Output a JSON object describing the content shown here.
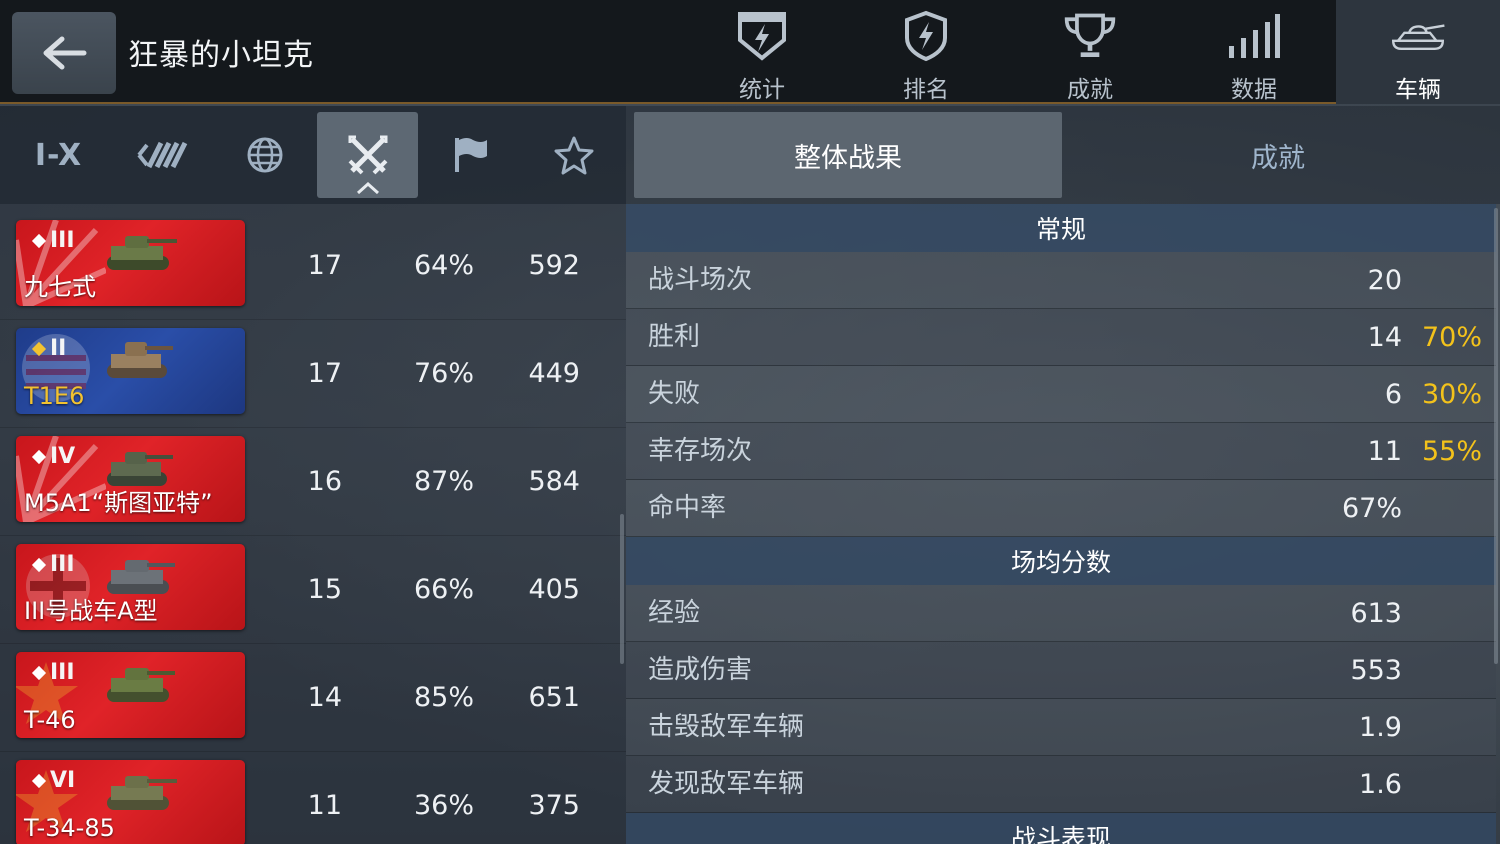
{
  "header": {
    "player_name": "狂暴的小坦克",
    "nav": [
      {
        "label": "统计",
        "icon": "shield-lightning-icon"
      },
      {
        "label": "排名",
        "icon": "badge-lightning-icon"
      },
      {
        "label": "成就",
        "icon": "trophy-icon"
      },
      {
        "label": "数据",
        "icon": "signal-bars-icon"
      },
      {
        "label": "车辆",
        "icon": "tank-icon",
        "active": true
      }
    ]
  },
  "filters": {
    "tier_label": "I-X",
    "items": [
      "tier-filter",
      "vehicle-type-filter",
      "nation-filter",
      "battles-sort",
      "flag-filter",
      "star-filter"
    ],
    "active": "battles-sort"
  },
  "tanks": [
    {
      "tier": "III",
      "name": "九七式",
      "battles": "17",
      "win_rate": "64%",
      "avg_exp": "592",
      "color": "red"
    },
    {
      "tier": "II",
      "name": "T1E6",
      "battles": "17",
      "win_rate": "76%",
      "avg_exp": "449",
      "color": "blue",
      "premium": true
    },
    {
      "tier": "IV",
      "name": "M5A1“斯图亚特”",
      "battles": "16",
      "win_rate": "87%",
      "avg_exp": "584",
      "color": "red"
    },
    {
      "tier": "III",
      "name": "III号战车A型",
      "battles": "15",
      "win_rate": "66%",
      "avg_exp": "405",
      "color": "red"
    },
    {
      "tier": "III",
      "name": "T-46",
      "battles": "14",
      "win_rate": "85%",
      "avg_exp": "651",
      "color": "red"
    },
    {
      "tier": "VI",
      "name": "T-34-85",
      "battles": "11",
      "win_rate": "36%",
      "avg_exp": "375",
      "color": "red"
    }
  ],
  "right_tabs": {
    "overall": "整体战果",
    "achievements": "成就"
  },
  "stats": {
    "general": {
      "title": "常规",
      "battles_label": "战斗场次",
      "battles": "20",
      "victories_label": "胜利",
      "victories": "14",
      "victories_pct": "70%",
      "defeats_label": "失败",
      "defeats": "6",
      "defeats_pct": "30%",
      "survived_label": "幸存场次",
      "survived": "11",
      "survived_pct": "55%",
      "hit_ratio_label": "命中率",
      "hit_ratio": "67%"
    },
    "average": {
      "title": "场均分数",
      "exp_label": "经验",
      "exp": "613",
      "damage_label": "造成伤害",
      "damage": "553",
      "kills_label": "击毁敌军车辆",
      "kills": "1.9",
      "spotted_label": "发现敌军车辆",
      "spotted": "1.6"
    },
    "performance": {
      "title": "战斗表现"
    }
  },
  "colors": {
    "accent_gold": "#f3c21b",
    "card_red": "#d81c22",
    "card_blue": "#2a4ea8",
    "section_head": "#324862"
  }
}
